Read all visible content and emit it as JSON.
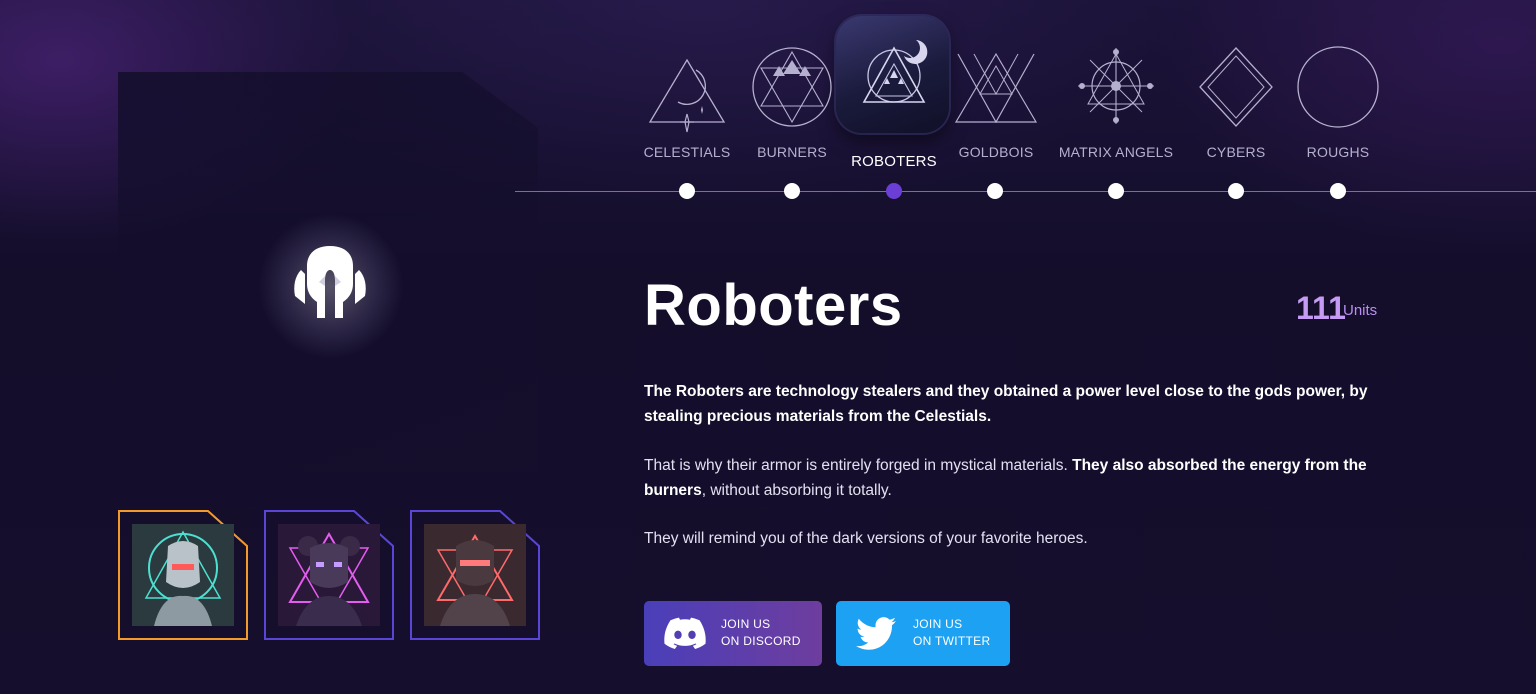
{
  "nav": {
    "items": [
      {
        "label": "CELESTIALS",
        "icon": "celestials-icon"
      },
      {
        "label": "BURNERS",
        "icon": "burners-icon"
      },
      {
        "label": "ROBOTERS",
        "icon": "roboters-icon",
        "active": true
      },
      {
        "label": "GOLDBOIS",
        "icon": "goldbois-icon"
      },
      {
        "label": "MATRIX ANGELS",
        "icon": "matrix-angels-icon"
      },
      {
        "label": "CYBERS",
        "icon": "cybers-icon"
      },
      {
        "label": "ROUGHS",
        "icon": "roughs-icon"
      }
    ]
  },
  "faction": {
    "name": "Roboters",
    "unit_count": "111",
    "unit_label": "Units",
    "paragraphs": {
      "p1": "The Roboters are technology stealers and they obtained a power level close to the gods power, by stealing precious materials from the Celestials.",
      "p2_normal_a": "That is why their armor is entirely forged in mystical materials. ",
      "p2_bold": "They also absorbed the energy from the burners",
      "p2_normal_b": ", without absorbing it totally.",
      "p3": "They will remind you of the dark versions of your favorite heroes."
    }
  },
  "buttons": {
    "discord": {
      "line1": "JOIN US",
      "line2": "ON DISCORD"
    },
    "twitter": {
      "line1": "JOIN US",
      "line2": "ON TWITTER"
    }
  },
  "colors": {
    "background": "#150f2e",
    "accent_purple": "#6b3fd6",
    "units_color": "#c59bf4",
    "discord_start": "#4a3fb9",
    "discord_end": "#6e3d9e",
    "twitter": "#1da1f2",
    "thumb_frame_selected": "#f39a2b",
    "thumb_frame": "#5a46d6"
  }
}
